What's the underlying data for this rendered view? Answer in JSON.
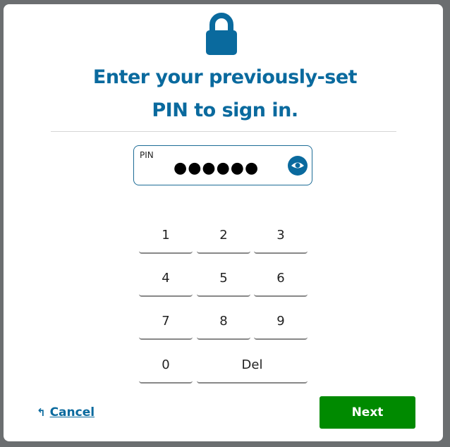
{
  "header": {
    "icon": "lock-icon",
    "title_line1": "Enter your previously-set",
    "title_line2": "PIN to sign in."
  },
  "pin_field": {
    "label": "PIN",
    "masked_value": "●●●●●●",
    "toggle_icon": "eye-icon"
  },
  "keypad": {
    "keys": [
      "1",
      "2",
      "3",
      "4",
      "5",
      "6",
      "7",
      "8",
      "9",
      "0",
      "Del"
    ]
  },
  "footer": {
    "cancel_label": "Cancel",
    "cancel_icon": "back-arrow-icon",
    "next_label": "Next"
  },
  "colors": {
    "brand": "#0a6a9e",
    "next_button": "#008a00"
  }
}
